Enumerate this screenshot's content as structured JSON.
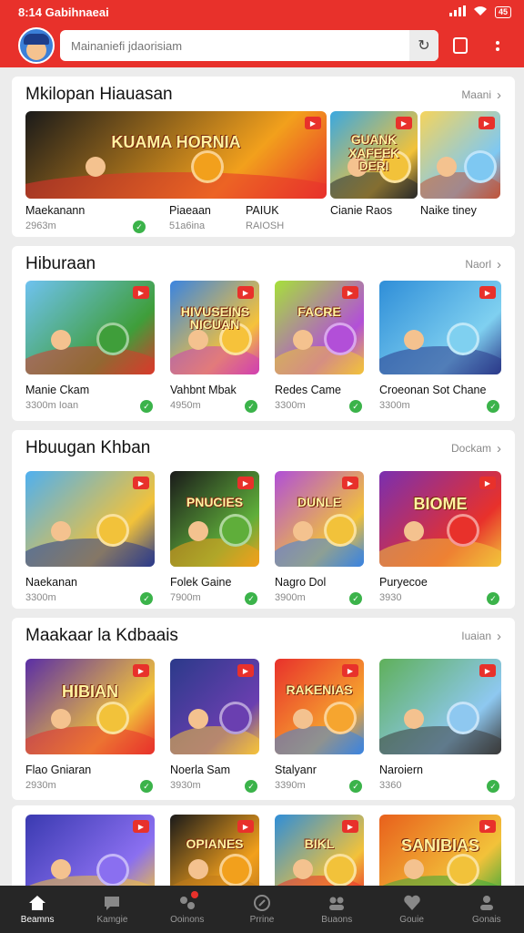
{
  "statusbar": {
    "time": "8:14 Gabihnaeai",
    "battery": "45"
  },
  "search": {
    "placeholder": "Mainaniefi jdaorisiam"
  },
  "sections": [
    {
      "title": "Mkilopan Hiauasan",
      "more": "Maani",
      "tiles": [
        {
          "name": "Maekanann",
          "meta": "2963m",
          "banner": "KUAMA HORNIA",
          "colors": [
            "#1a1a1a",
            "#f2a01c",
            "#e8312b"
          ]
        },
        {
          "name": "Piaeaan",
          "meta": "51a6ina",
          "banner": "",
          "colors": [
            "#5b2ea6",
            "#f07a1c",
            "#f6c23a"
          ]
        },
        {
          "name": "PAIUK",
          "meta": "RAIOSH",
          "banner": "",
          "colors": [
            "#d43f2d",
            "#f6a52f",
            "#274da8"
          ]
        },
        {
          "name": "Cianie Raos",
          "meta": "",
          "banner": "GUANK XAFEEK DERI",
          "colors": [
            "#3aa8e0",
            "#f2c23a",
            "#2a2a2a"
          ]
        },
        {
          "name": "Naike tiney",
          "meta": "",
          "banner": "",
          "colors": [
            "#f5d45c",
            "#7ec8f2",
            "#c0533a"
          ]
        }
      ]
    },
    {
      "title": "Hiburaan",
      "more": "Naorl",
      "tiles": [
        {
          "name": "Manie Ckam",
          "meta": "3300m Ioan",
          "banner": "",
          "colors": [
            "#6fc2f0",
            "#3f9e3a",
            "#d83a2b"
          ]
        },
        {
          "name": "Vahbnt Mbak",
          "meta": "4950m",
          "banner": "HIVUSEINS NICUAN",
          "colors": [
            "#3a84e0",
            "#f6c23a",
            "#d13fb0"
          ]
        },
        {
          "name": "Redes Came",
          "meta": "3300m",
          "banner": "FACRE",
          "colors": [
            "#a6e03a",
            "#b24fd8",
            "#f2c23a"
          ]
        },
        {
          "name": "Croeonan Sot Chane",
          "meta": "3300m",
          "banner": "",
          "colors": [
            "#2f8ed8",
            "#7fd0f0",
            "#2b3a8a"
          ]
        }
      ]
    },
    {
      "title": "Hbuugan Khban",
      "more": "Dockam",
      "tiles": [
        {
          "name": "Naekanan",
          "meta": "3300m",
          "banner": "",
          "colors": [
            "#4fb0f0",
            "#f2c23a",
            "#2b3a8a"
          ]
        },
        {
          "name": "Folek Gaine",
          "meta": "7900m",
          "banner": "PNUCIES",
          "colors": [
            "#1a1a1a",
            "#5fae3a",
            "#f2a01c"
          ]
        },
        {
          "name": "Nagro Dol",
          "meta": "3900m",
          "banner": "DUNLE",
          "colors": [
            "#b04fd8",
            "#f2c23a",
            "#3a84e0"
          ]
        },
        {
          "name": "Puryecoe",
          "meta": "3930",
          "banner": "BIOME",
          "colors": [
            "#7a2fb0",
            "#e8312b",
            "#f2c23a"
          ]
        }
      ]
    },
    {
      "title": "Maakaar la Kdbaais",
      "more": "Iuaian",
      "tiles": [
        {
          "name": "Flao Gniaran",
          "meta": "2930m",
          "banner": "HIBIAN",
          "colors": [
            "#5a2ea6",
            "#f2c23a",
            "#e8312b"
          ]
        },
        {
          "name": "Noerla Sam",
          "meta": "3930m",
          "banner": "",
          "colors": [
            "#2b3a8a",
            "#6a3fb0",
            "#f6c23a"
          ]
        },
        {
          "name": "Stalyanr",
          "meta": "3390m",
          "banner": "RAKENIAS",
          "colors": [
            "#e8312b",
            "#f6a52f",
            "#3a84e0"
          ]
        },
        {
          "name": "Naroiern",
          "meta": "3360",
          "banner": "",
          "colors": [
            "#5fb05a",
            "#8ec8f0",
            "#3a3a3a"
          ]
        }
      ]
    },
    {
      "title": "",
      "more": "",
      "tiles": [
        {
          "name": "",
          "meta": "",
          "banner": "",
          "colors": [
            "#3a3ab0",
            "#8a6ff0",
            "#f2c23a"
          ]
        },
        {
          "name": "",
          "meta": "",
          "banner": "OPIANES",
          "colors": [
            "#1a1a1a",
            "#f2a01c",
            "#c07a1c"
          ]
        },
        {
          "name": "",
          "meta": "",
          "banner": "BIKL",
          "colors": [
            "#2f8ed8",
            "#f2c23a",
            "#e8312b"
          ]
        },
        {
          "name": "",
          "meta": "",
          "banner": "SANIBIAS",
          "colors": [
            "#e8601c",
            "#f2c23a",
            "#3aa83a"
          ]
        }
      ]
    }
  ],
  "nav": [
    {
      "label": "Beamns",
      "icon": "home-icon",
      "active": true
    },
    {
      "label": "Kamgie",
      "icon": "chat-icon",
      "active": false
    },
    {
      "label": "Ooinons",
      "icon": "game-icon",
      "active": false,
      "badge": true
    },
    {
      "label": "Prrine",
      "icon": "compass-icon",
      "active": false
    },
    {
      "label": "Buaons",
      "icon": "group-icon",
      "active": false
    },
    {
      "label": "Gouie",
      "icon": "heart-icon",
      "active": false
    },
    {
      "label": "Gonais",
      "icon": "profile-icon",
      "active": false
    }
  ],
  "colors": {
    "accent": "#e8312b",
    "nav_bg": "#262626",
    "check": "#3bb34a"
  }
}
